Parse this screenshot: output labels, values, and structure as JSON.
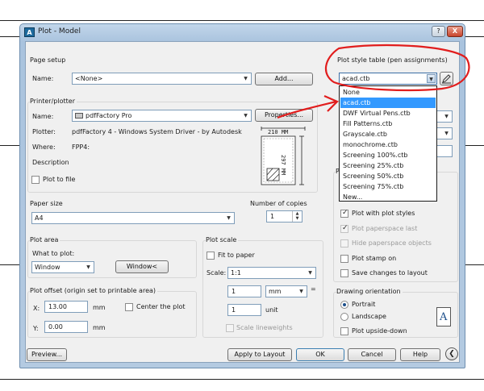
{
  "window": {
    "title": "Plot - Model",
    "app_icon": "A",
    "help_btn": "?",
    "close_btn": "X"
  },
  "page_setup": {
    "section": "Page setup",
    "name_label": "Name:",
    "name_value": "<None>",
    "add_button": "Add..."
  },
  "printer": {
    "section": "Printer/plotter",
    "name_label": "Name:",
    "name_value": "pdfFactory Pro",
    "properties_button": "Properties...",
    "plotter_label": "Plotter:",
    "plotter_value": "pdfFactory 4 - Windows System Driver - by Autodesk",
    "where_label": "Where:",
    "where_value": "FPP4:",
    "description_label": "Description",
    "plot_to_file": "Plot to file",
    "paper_width": "210  MM",
    "paper_height": "297  MM"
  },
  "paper_size": {
    "section": "Paper size",
    "value": "A4"
  },
  "copies": {
    "label": "Number of copies",
    "value": "1"
  },
  "plot_area": {
    "section": "Plot area",
    "what_label": "What to plot:",
    "what_value": "Window",
    "window_button": "Window<"
  },
  "plot_scale": {
    "section": "Plot scale",
    "fit_label": "Fit to paper",
    "scale_label": "Scale:",
    "scale_value": "1:1",
    "value1": "1",
    "unit_value": "mm",
    "equals": "=",
    "value2": "1",
    "unit_label": "unit",
    "scale_lineweights": "Scale lineweights"
  },
  "plot_offset": {
    "section": "Plot offset (origin set to printable area)",
    "x_label": "X:",
    "x_value": "13.00",
    "x_unit": "mm",
    "center_label": "Center the plot",
    "y_label": "Y:",
    "y_value": "0.00",
    "y_unit": "mm"
  },
  "plot_style": {
    "section": "Plot style table (pen assignments)",
    "selected": "acad.ctb",
    "list": [
      "None",
      "acad.ctb",
      "DWF Virtual Pens.ctb",
      "Fill Patterns.ctb",
      "Grayscale.ctb",
      "monochrome.ctb",
      "Screening 100%.ctb",
      "Screening 25%.ctb",
      "Screening 50%.ctb",
      "Screening 75%.ctb",
      "New..."
    ],
    "list_selected_index": 1
  },
  "plot_options": {
    "partial_label": "Pl",
    "plot_with_styles": "Plot with plot styles",
    "plot_paperspace_last": "Plot paperspace last",
    "hide_paperspace": "Hide paperspace objects",
    "plot_stamp": "Plot stamp on",
    "save_changes": "Save changes to layout"
  },
  "orientation": {
    "section": "Drawing orientation",
    "portrait": "Portrait",
    "landscape": "Landscape",
    "upside_down": "Plot upside-down",
    "page_icon": "A"
  },
  "footer": {
    "preview": "Preview...",
    "apply": "Apply to Layout",
    "ok": "OK",
    "cancel": "Cancel",
    "help": "Help"
  },
  "colors": {
    "annotation_red": "#e11d1d",
    "selection_blue": "#3399ff"
  }
}
